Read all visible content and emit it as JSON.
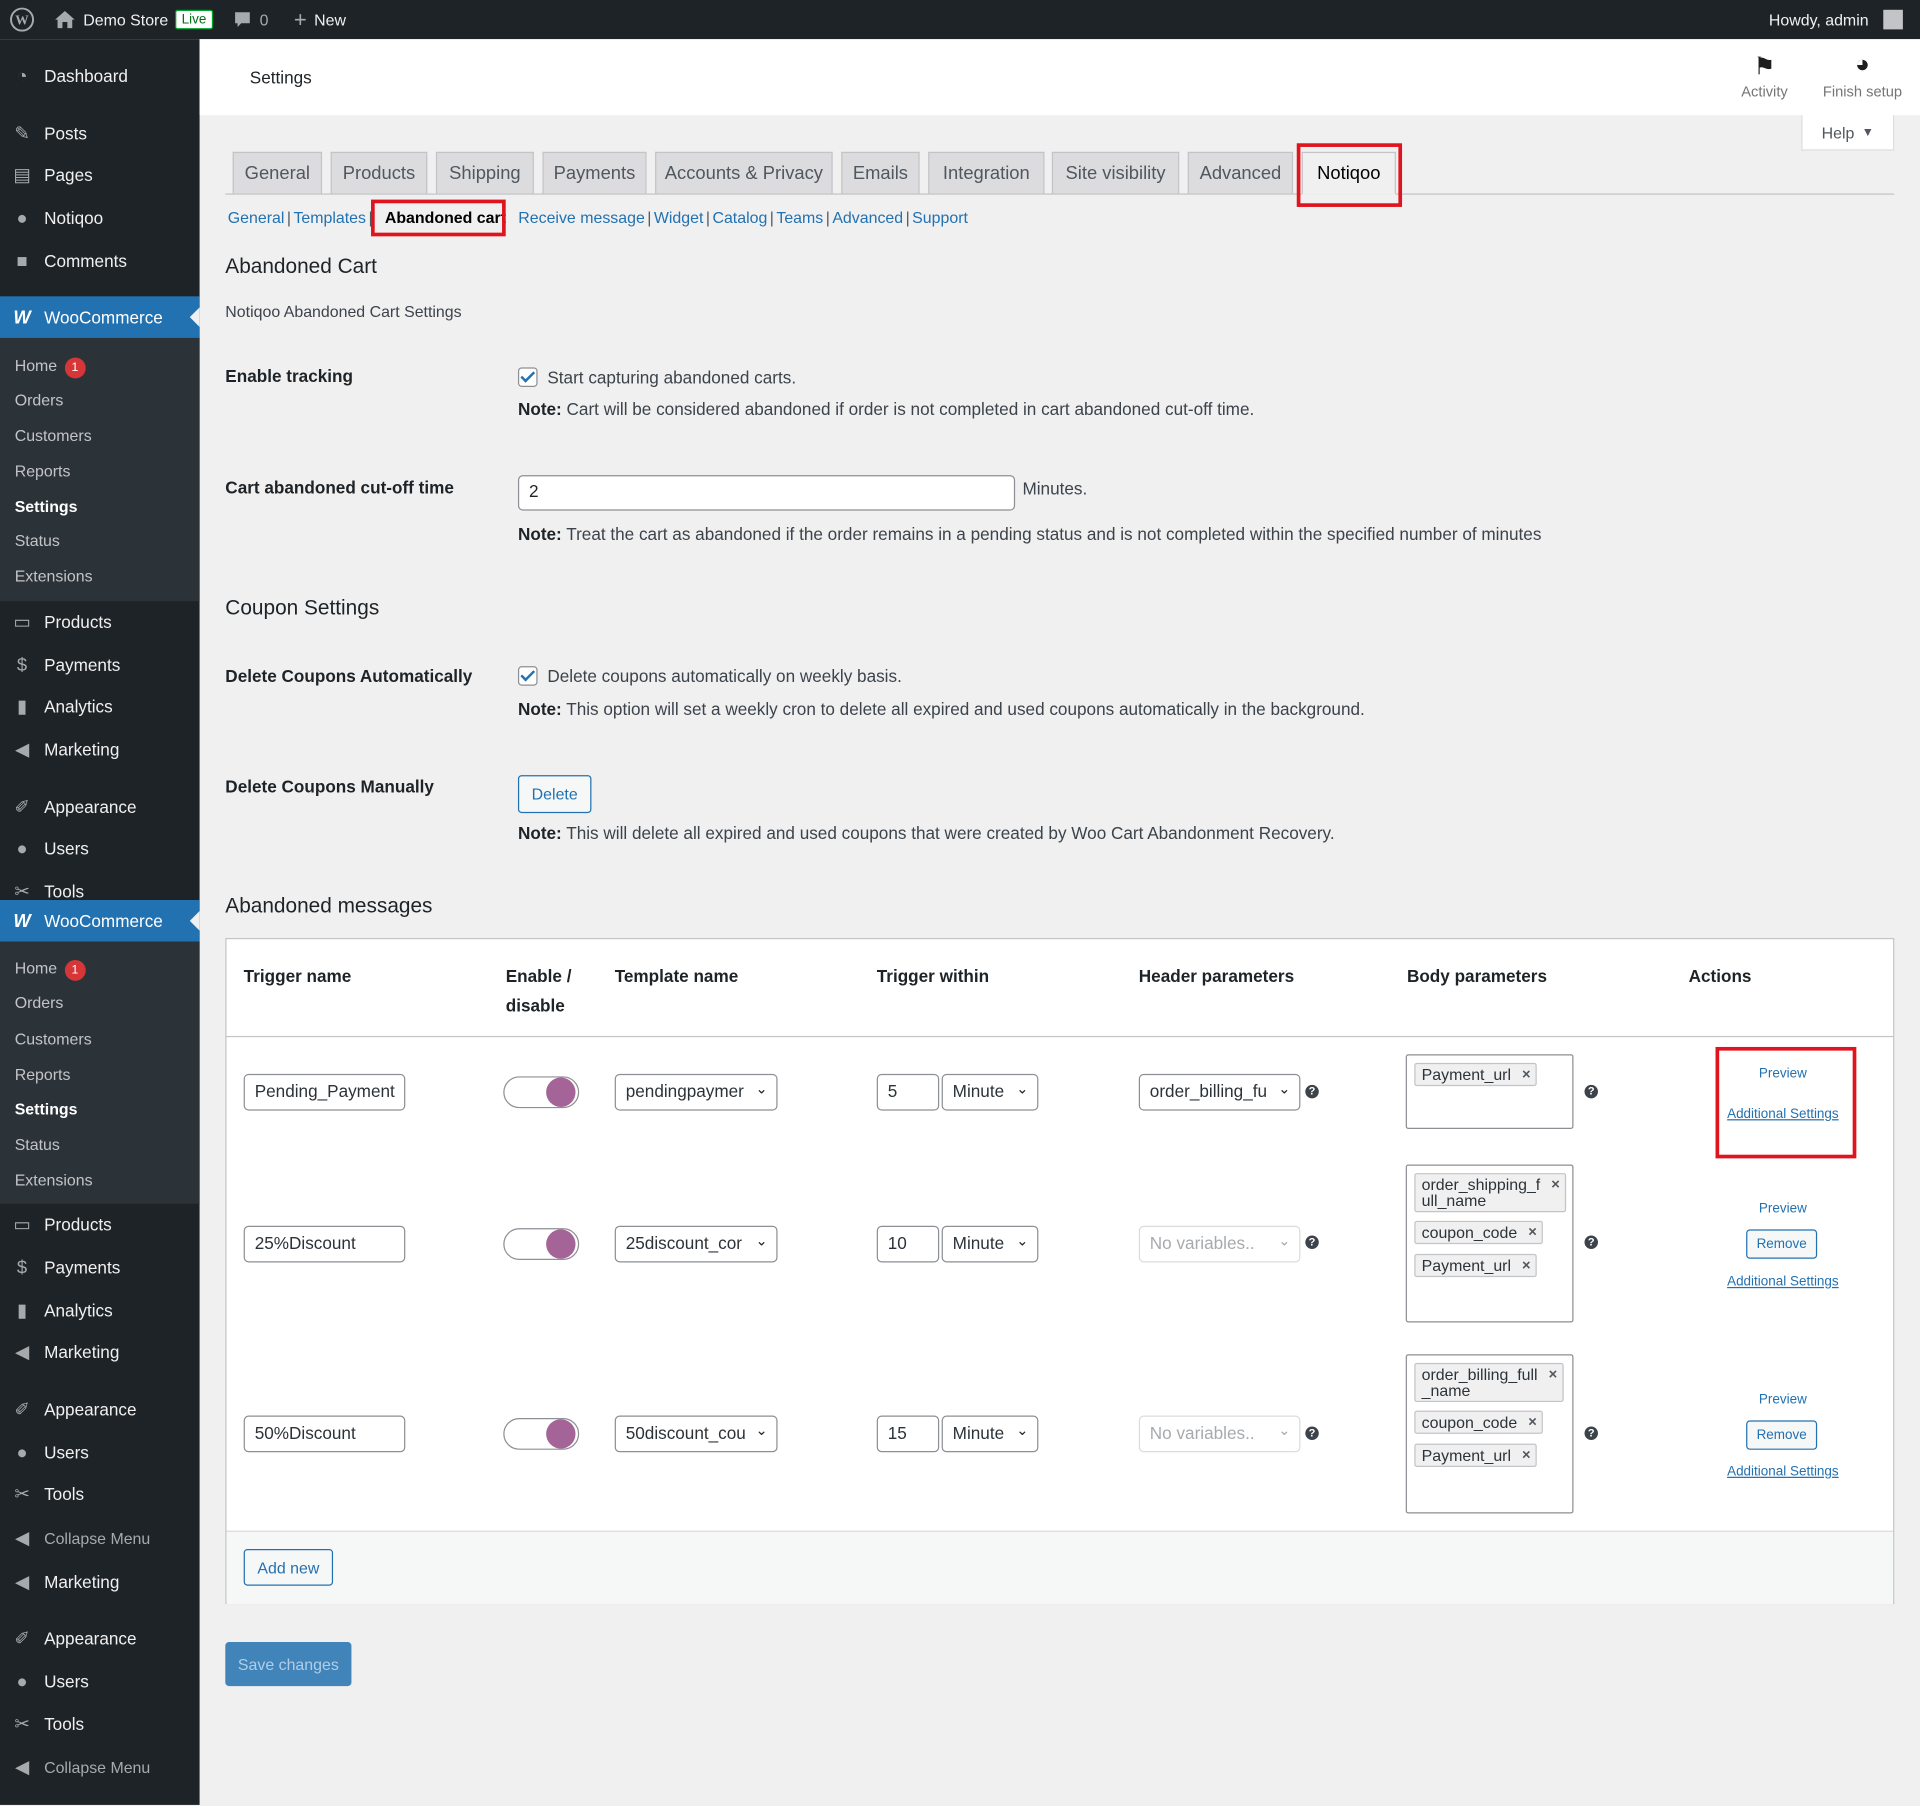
{
  "adminbar": {
    "site_name": "Demo Store",
    "live_badge": "Live",
    "comments_count": "0",
    "new_label": "New",
    "howdy": "Howdy, admin"
  },
  "sidebar": {
    "dashboard": "Dashboard",
    "posts": "Posts",
    "pages": "Pages",
    "notiqoo": "Notiqoo",
    "comments": "Comments",
    "woocommerce": "WooCommerce",
    "woo_sub": [
      "Home",
      "Orders",
      "Customers",
      "Reports",
      "Settings",
      "Status",
      "Extensions"
    ],
    "home_badge": "1",
    "products": "Products",
    "payments": "Payments",
    "analytics": "Analytics",
    "marketing": "Marketing",
    "appearance": "Appearance",
    "users": "Users",
    "tools": "Tools",
    "collapse": "Collapse Menu"
  },
  "header": {
    "title": "Settings",
    "activity": "Activity",
    "finish_setup": "Finish setup",
    "help": "Help"
  },
  "tabs": [
    "General",
    "Products",
    "Shipping",
    "Payments",
    "Accounts & Privacy",
    "Emails",
    "Integration",
    "Site visibility",
    "Advanced",
    "Notiqoo"
  ],
  "subtabs": [
    "General",
    "Templates",
    "Abandoned cart",
    "Receive message",
    "Widget",
    "Catalog",
    "Teams",
    "Advanced",
    "Support"
  ],
  "section": {
    "title": "Abandoned Cart",
    "description": "Notiqoo Abandoned Cart Settings",
    "enable_tracking_label": "Enable tracking",
    "enable_tracking_text": "Start capturing abandoned carts.",
    "note_label": "Note:",
    "enable_tracking_note": "Cart will be considered abandoned if order is not completed in cart abandoned cut-off time.",
    "cutoff_label": "Cart abandoned cut-off time",
    "cutoff_value": "2",
    "cutoff_unit": "Minutes.",
    "cutoff_note": "Treat the cart as abandoned if the order remains in a pending status and is not completed within the specified number of minutes",
    "coupon_title": "Coupon Settings",
    "delete_auto_label": "Delete Coupons Automatically",
    "delete_auto_text": "Delete coupons automatically on weekly basis.",
    "delete_auto_note": "This option will set a weekly cron to delete all expired and used coupons automatically in the background.",
    "delete_manual_label": "Delete Coupons Manually",
    "delete_button": "Delete",
    "delete_manual_note": "This will delete all expired and used coupons that were created by Woo Cart Abandonment Recovery.",
    "messages_title": "Abandoned messages"
  },
  "table": {
    "headers": {
      "trigger_name": "Trigger name",
      "enable_1": "Enable /",
      "enable_2": "disable",
      "template_name": "Template name",
      "trigger_within": "Trigger within",
      "header_params": "Header parameters",
      "body_params": "Body parameters",
      "actions": "Actions"
    },
    "rows": [
      {
        "name": "Pending_Payment",
        "template": "pendingpaymer",
        "within": "5",
        "unit": "Minute",
        "header_param": "order_billing_fu",
        "body": [
          "Payment_url"
        ],
        "preview": "Preview",
        "additional": "Additional Settings"
      },
      {
        "name": "25%Discount",
        "template": "25discount_cor",
        "within": "10",
        "unit": "Minute",
        "header_param": "No variables..",
        "body": [
          "order_shipping_f\null_name",
          "coupon_code",
          "Payment_url"
        ],
        "preview": "Preview",
        "remove": "Remove",
        "additional": "Additional Settings"
      },
      {
        "name": "50%Discount",
        "template": "50discount_cou",
        "within": "15",
        "unit": "Minute",
        "header_param": "No variables..",
        "body": [
          "order_billing_full\n_name",
          "coupon_code",
          "Payment_url"
        ],
        "preview": "Preview",
        "remove": "Remove",
        "additional": "Additional Settings"
      }
    ],
    "add_new": "Add new"
  },
  "save_changes": "Save changes",
  "colors": {
    "accent": "#2271b1",
    "highlight": "#e0141e",
    "toggle_knob": "#a46497",
    "sidebar": "#1d2327"
  }
}
